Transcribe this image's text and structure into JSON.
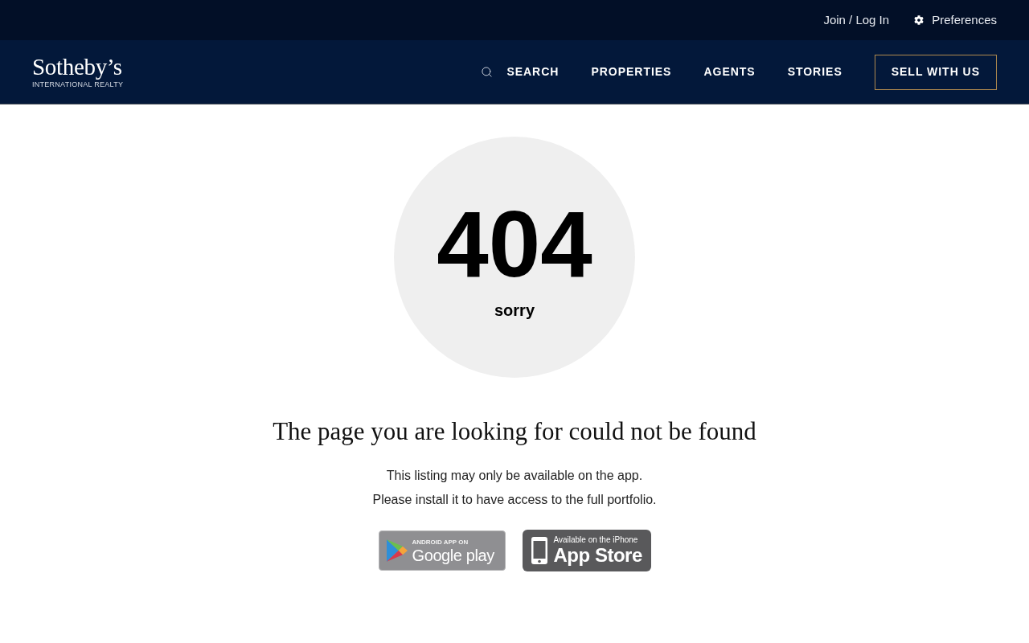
{
  "top_bar": {
    "links": [
      {
        "kind": "plain",
        "label": "Join / Log In"
      },
      {
        "kind": "settings",
        "label": "Preferences"
      }
    ]
  },
  "logo": {
    "wordmark": "Sotheby’s",
    "tagline": "INTERNATIONAL REALTY"
  },
  "nav": {
    "items": [
      {
        "kind": "search",
        "label": "SEARCH"
      },
      {
        "kind": "link",
        "label": "PROPERTIES"
      },
      {
        "kind": "link",
        "label": "AGENTS"
      },
      {
        "kind": "link",
        "label": "STORIES"
      },
      {
        "kind": "cta",
        "label": "SELL WITH US"
      }
    ]
  },
  "error": {
    "code": "404",
    "caption": "sorry",
    "heading": "The page you are looking for could not be found",
    "lines": [
      "This listing may only be available on the app.",
      "Please install it to have access to the full portfolio."
    ]
  },
  "app_badges": [
    {
      "kind": "google_play",
      "small_text": "ANDROID APP ON",
      "large_text": "Google play"
    },
    {
      "kind": "app_store",
      "small_text": "Available on the iPhone",
      "large_text": "App Store"
    }
  ]
}
